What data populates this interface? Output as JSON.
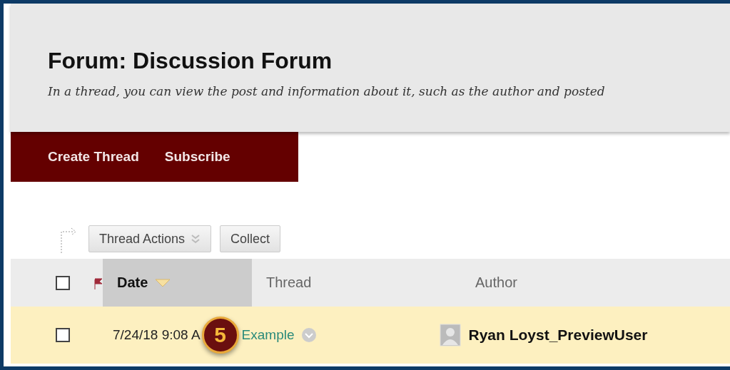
{
  "header": {
    "title": "Forum: Discussion Forum",
    "description": "In a thread, you can view the post and information about it, such as the author and posted"
  },
  "action_bar": [
    "Create Thread",
    "Subscribe"
  ],
  "toolbar": {
    "thread_actions": "Thread Actions",
    "collect": "Collect"
  },
  "table": {
    "select_all_checked": false,
    "columns": [
      {
        "label": "Date",
        "sorted": true
      },
      {
        "label": "Thread",
        "sorted": false
      },
      {
        "label": "Author",
        "sorted": false
      }
    ],
    "rows": [
      {
        "checked": false,
        "date": "7/24/18 9:08 A",
        "thread": "Example",
        "author": "Ryan Loyst_PreviewUser"
      }
    ]
  },
  "callout": {
    "number": "5"
  }
}
